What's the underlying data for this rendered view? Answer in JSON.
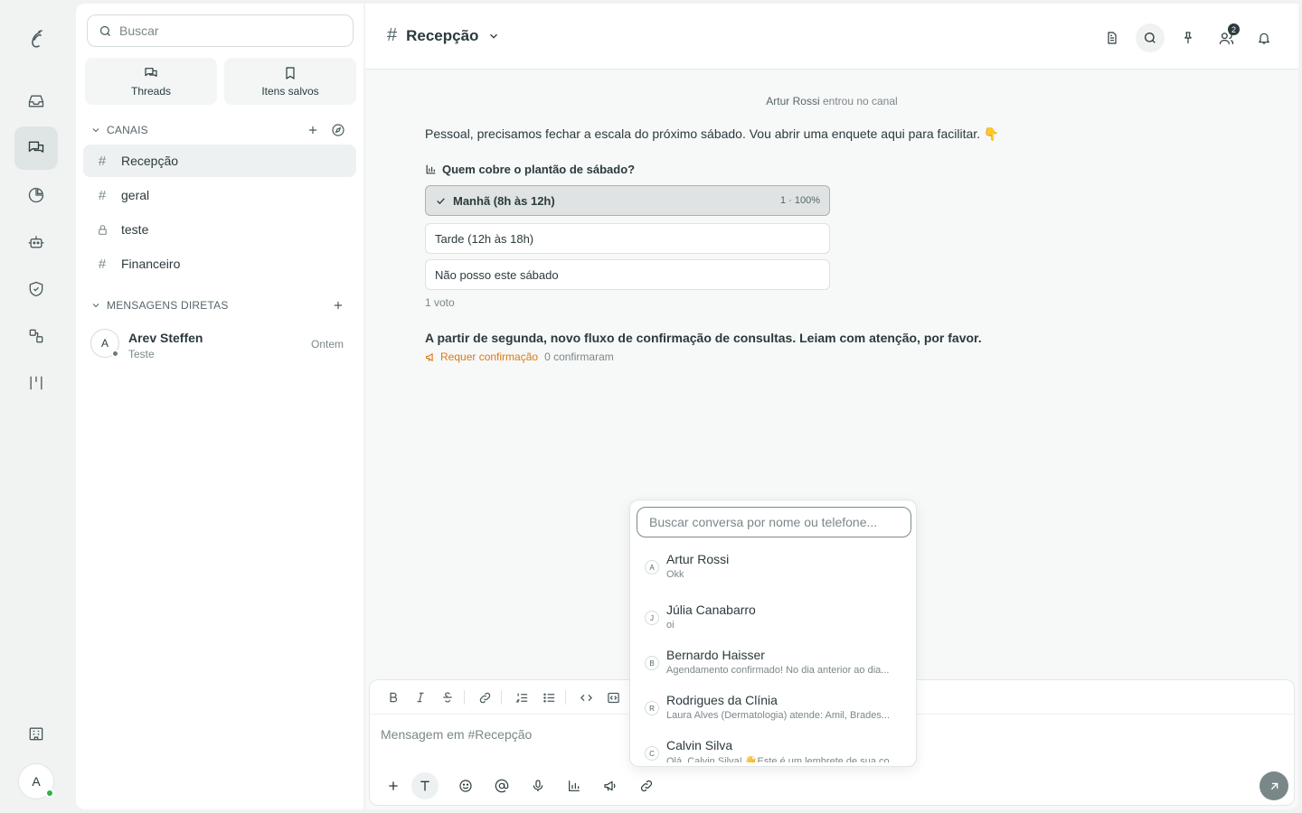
{
  "sidebar": {
    "search_placeholder": "Buscar",
    "quick": [
      {
        "label": "Threads"
      },
      {
        "label": "Itens salvos"
      }
    ],
    "channels_header": "CANAIS",
    "channels": [
      {
        "name": "Recepção",
        "icon": "hash-icon",
        "active": true
      },
      {
        "name": "geral",
        "icon": "hash-icon"
      },
      {
        "name": "teste",
        "icon": "lock-icon"
      },
      {
        "name": "Financeiro",
        "icon": "hash-icon"
      }
    ],
    "dm_header": "MENSAGENS DIRETAS",
    "dms": [
      {
        "initial": "A",
        "name": "Arev Steffen",
        "preview": "Teste",
        "time": "Ontem"
      }
    ]
  },
  "rail": {
    "avatar_initial": "A",
    "status_color": "#2bb24c"
  },
  "header": {
    "channel_name": "Recepção",
    "members_badge": "2"
  },
  "messages": {
    "system": {
      "user": "Artur Rossi",
      "text": "entrou no canal"
    },
    "text1": "Pessoal, precisamos fechar a escala do próximo sábado. Vou abrir uma enquete aqui para facilitar. 👇",
    "poll": {
      "question": "Quem cobre o plantão de sábado?",
      "options": [
        {
          "label": "Manhã (8h às 12h)",
          "result": "1 · 100%",
          "selected": true
        },
        {
          "label": "Tarde (12h às 18h)",
          "result": ""
        },
        {
          "label": "Não posso este sábado",
          "result": ""
        }
      ],
      "votes": "1 voto"
    },
    "announcement": {
      "text": "A partir de segunda, novo fluxo de confirmação de consultas. Leiam com atenção, por favor.",
      "ack_label": "Requer confirmação",
      "ack_count": "0 confirmaram"
    }
  },
  "composer": {
    "placeholder": "Mensagem em #Recepção"
  },
  "popup": {
    "search_placeholder": "Buscar conversa por nome ou telefone...",
    "results": [
      {
        "initial": "A",
        "name": "Artur Rossi",
        "preview": "Okk"
      },
      {
        "initial": "J",
        "name": "Júlia Canabarro",
        "preview": "oi"
      },
      {
        "initial": "B",
        "name": "Bernardo Haisser",
        "preview": "Agendamento confirmado! No dia anterior ao dia..."
      },
      {
        "initial": "R",
        "name": "Rodrigues da Clínia",
        "preview": "Laura Alves (Dermatologia) atende: Amil, Brades..."
      },
      {
        "initial": "C",
        "name": "Calvin Silva",
        "preview": "Olá, Calvin Silva! 👋Este é um lembrete de sua co..."
      }
    ]
  },
  "colors": {
    "accent_warning": "#d97a14",
    "send_button": "#7a8789"
  }
}
